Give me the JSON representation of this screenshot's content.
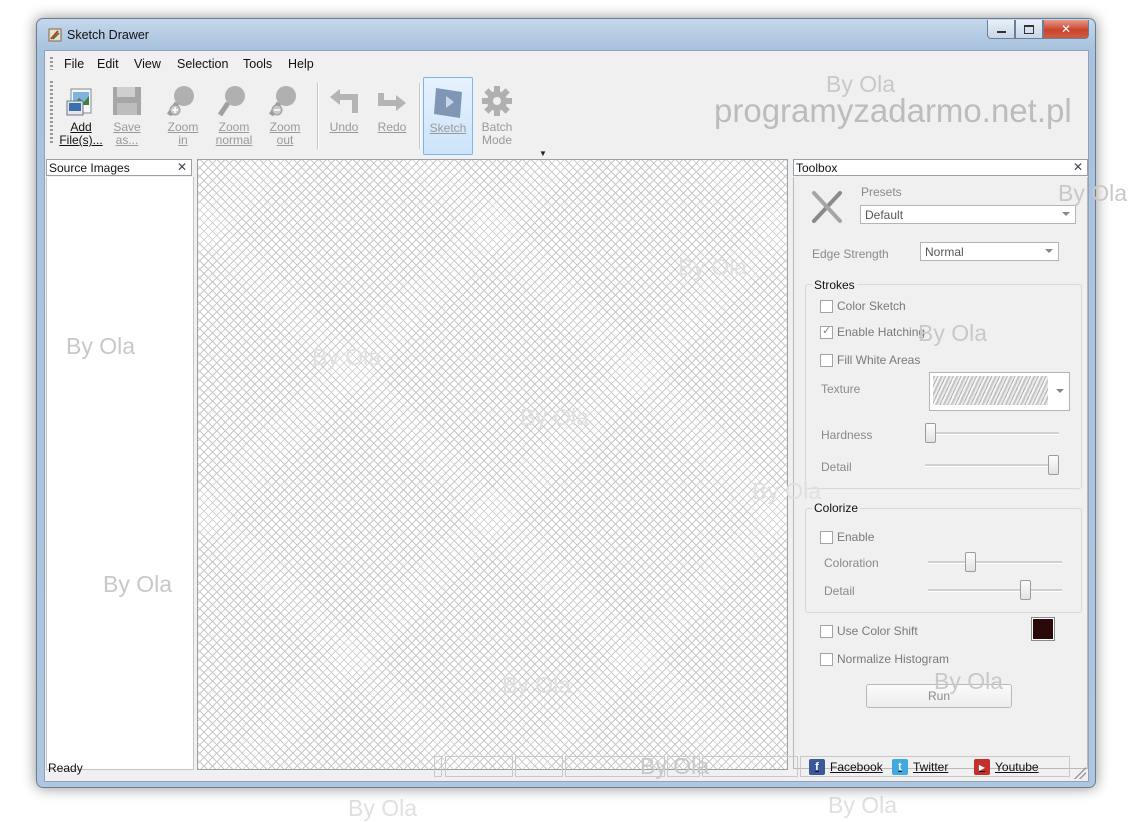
{
  "window": {
    "title": "Sketch Drawer"
  },
  "menu": [
    {
      "label": "File"
    },
    {
      "label": "Edit"
    },
    {
      "label": "View"
    },
    {
      "label": "Selection"
    },
    {
      "label": "Tools"
    },
    {
      "label": "Help"
    }
  ],
  "toolbar": [
    {
      "label": "Add\nFile(s)...",
      "icon": "add-files-icon",
      "enabled": true
    },
    {
      "label": "Save\nas...",
      "icon": "save-icon",
      "enabled": false
    },
    {
      "label": "Zoom\nin",
      "icon": "zoom-in-icon",
      "enabled": false
    },
    {
      "label": "Zoom\nnormal",
      "icon": "zoom-normal-icon",
      "enabled": false
    },
    {
      "label": "Zoom\nout",
      "icon": "zoom-out-icon",
      "enabled": false
    },
    {
      "label": "Undo",
      "icon": "undo-icon",
      "enabled": false
    },
    {
      "label": "Redo",
      "icon": "redo-icon",
      "enabled": false
    },
    {
      "label": "Sketch",
      "icon": "sketch-icon",
      "enabled": false,
      "active": true
    },
    {
      "label": "Batch\nMode",
      "icon": "gear-icon",
      "enabled": false
    }
  ],
  "panels": {
    "source_images": {
      "title": "Source Images"
    },
    "toolbox": {
      "title": "Toolbox"
    }
  },
  "toolbox": {
    "presets_label": "Presets",
    "presets_value": "Default",
    "edge_strength_label": "Edge Strength",
    "edge_strength_value": "Normal",
    "strokes": {
      "title": "Strokes",
      "color_sketch": {
        "label": "Color Sketch",
        "checked": false
      },
      "enable_hatching": {
        "label": "Enable Hatching",
        "checked": true
      },
      "fill_white_areas": {
        "label": "Fill White Areas",
        "checked": false
      },
      "texture_label": "Texture",
      "hardness_label": "Hardness",
      "hardness_level": 0.0,
      "detail_label": "Detail",
      "detail_level": 1.0
    },
    "colorize": {
      "title": "Colorize",
      "enable": {
        "label": "Enable",
        "checked": false
      },
      "coloration_label": "Coloration",
      "coloration_level": 0.3,
      "detail_label": "Detail",
      "detail_level": 0.75
    },
    "use_color_shift": {
      "label": "Use Color Shift",
      "checked": false
    },
    "color_shift_color": "#2a0a08",
    "normalize_histogram": {
      "label": "Normalize Histogram",
      "checked": false
    },
    "run_label": "Run"
  },
  "status": {
    "text": "Ready",
    "facebook": "Facebook",
    "twitter": "Twitter",
    "youtube": "Youtube"
  },
  "watermark": {
    "site": "programyzadarmo.net.pl",
    "tag": "By Ola"
  },
  "colors": {
    "accent": "#7eb4ea",
    "titlebar": "#b7cde6",
    "close": "#c8442c"
  }
}
